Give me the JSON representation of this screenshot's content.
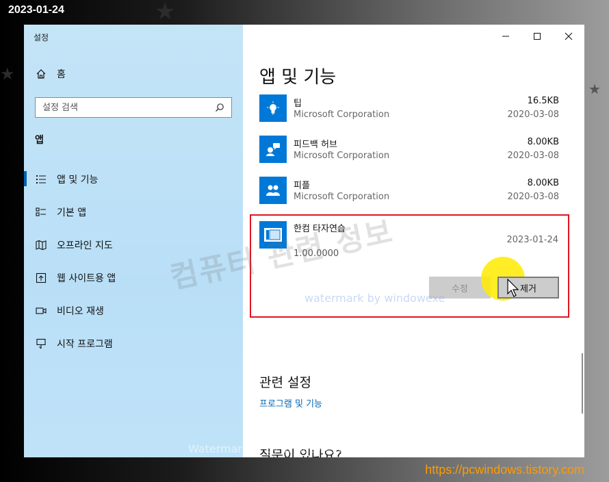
{
  "overlay": {
    "date_stamp": "2023-01-24",
    "site_url": "https://pcwindows.tistory.com",
    "watermark_korean": "컴퓨터 관련 정보",
    "watermark_blue": "watermark by windowexe",
    "watermark_bottom": "Watermarked by WindowexeWatermark",
    "cursor_highlight_color": "#ffeb00"
  },
  "window": {
    "title": "설정",
    "controls": [
      "minimize-icon",
      "maximize-icon",
      "close-icon"
    ]
  },
  "sidebar": {
    "home": {
      "label": "홈",
      "icon": "home-icon"
    },
    "search": {
      "placeholder": "설정 검색",
      "icon": "search-icon"
    },
    "section": "앱",
    "items": [
      {
        "label": "앱 및 기능",
        "icon": "apps-features-icon",
        "active": true
      },
      {
        "label": "기본 앱",
        "icon": "default-apps-icon",
        "active": false
      },
      {
        "label": "오프라인 지도",
        "icon": "offline-maps-icon",
        "active": false
      },
      {
        "label": "웹 사이트용 앱",
        "icon": "web-apps-icon",
        "active": false
      },
      {
        "label": "비디오 재생",
        "icon": "video-playback-icon",
        "active": false
      },
      {
        "label": "시작 프로그램",
        "icon": "startup-icon",
        "active": false
      }
    ]
  },
  "main": {
    "title": "앱 및 기능",
    "apps": [
      {
        "name": "팁",
        "publisher": "Microsoft Corporation",
        "size": "16.5KB",
        "date": "2020-03-08",
        "icon": "lightbulb-icon"
      },
      {
        "name": "피드백 허브",
        "publisher": "Microsoft Corporation",
        "size": "8.00KB",
        "date": "2020-03-08",
        "icon": "feedback-hub-icon"
      },
      {
        "name": "피플",
        "publisher": "Microsoft Corporation",
        "size": "8.00KB",
        "date": "2020-03-08",
        "icon": "people-icon"
      }
    ],
    "selected_app": {
      "name": "한컴 타자연습",
      "date": "2023-01-24",
      "version": "1.00.0000",
      "icon": "typing-app-icon",
      "modify_label": "수정",
      "remove_label": "제거",
      "highlight_color": "#e0141e"
    },
    "related": {
      "title": "관련 설정",
      "link": "프로그램 및 기능"
    },
    "question_title": "질문이 있나요?"
  },
  "colors": {
    "accent": "#0078d7",
    "sidebar_bg": "#bfe2f8",
    "link": "#0066b4"
  }
}
